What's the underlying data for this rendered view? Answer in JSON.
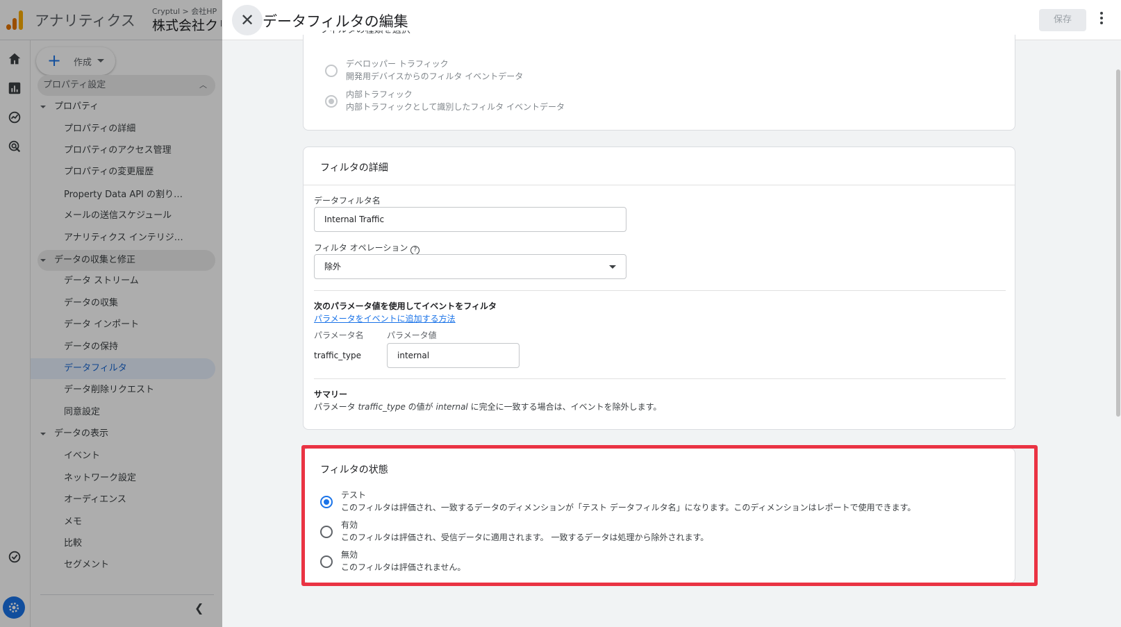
{
  "app": {
    "name": "アナリティクス",
    "crumb_account": "Cryptul",
    "crumb_property": "会社HP",
    "crumb_separator": ">",
    "property_big": "株式会社クリプトゥル"
  },
  "sidenav": {
    "create_label": "作成",
    "section_label": "プロパティ設定",
    "groups": [
      {
        "label": "プロパティ"
      },
      {
        "label": "データの収集と修正"
      },
      {
        "label": "データの表示"
      }
    ],
    "items": [
      "プロパティの詳細",
      "プロパティのアクセス管理",
      "プロパティの変更履歴",
      "Property Data API の割り当て",
      "メールの送信スケジュール",
      "アナリティクス インテリジェンス",
      "データ ストリーム",
      "データの収集",
      "データ インポート",
      "データの保持",
      "データフィルタ",
      "データ削除リクエスト",
      "同意設定",
      "イベント",
      "ネットワーク設定",
      "オーディエンス",
      "メモ",
      "比較",
      "セグメント"
    ]
  },
  "panel": {
    "title": "データフィルタの編集",
    "save_label": "保存"
  },
  "filter_type": {
    "heading": "フィルタの種類を選択",
    "options": [
      {
        "title": "デベロッパー トラフィック",
        "desc": "開発用デバイスからのフィルタ イベントデータ",
        "selected": false
      },
      {
        "title": "内部トラフィック",
        "desc": "内部トラフィックとして識別したフィルタ イベントデータ",
        "selected": true
      }
    ]
  },
  "details": {
    "heading": "フィルタの詳細",
    "name_label": "データフィルタ名",
    "name_value": "Internal Traffic",
    "operation_label": "フィルタ オペレーション",
    "operation_value": "除外",
    "param_heading": "次のパラメータ値を使用してイベントをフィルタ",
    "param_link": "パラメータをイベントに追加する方法",
    "param_name_label": "パラメータ名",
    "param_value_label": "パラメータ値",
    "param_name": "traffic_type",
    "param_value": "internal",
    "summary_heading": "サマリー",
    "summary_prefix": "パラメータ ",
    "summary_param": "traffic_type",
    "summary_mid": " の値が ",
    "summary_value": "internal",
    "summary_suffix": " に完全に一致する場合は、イベントを除外します。"
  },
  "status": {
    "heading": "フィルタの状態",
    "options": [
      {
        "title": "テスト",
        "desc": "このフィルタは評価され、一致するデータのディメンションが「テスト データフィルタ名」になります。このディメンションはレポートで使用できます。",
        "selected": true
      },
      {
        "title": "有効",
        "desc": "このフィルタは評価され、受信データに適用されます。 一致するデータは処理から除外されます。",
        "selected": false
      },
      {
        "title": "無効",
        "desc": "このフィルタは評価されません。",
        "selected": false
      }
    ]
  },
  "colors": {
    "accent": "#1a73e8",
    "highlight": "#ea3343",
    "brand_orange": "#e37400",
    "brand_yellow": "#f9ab00"
  }
}
